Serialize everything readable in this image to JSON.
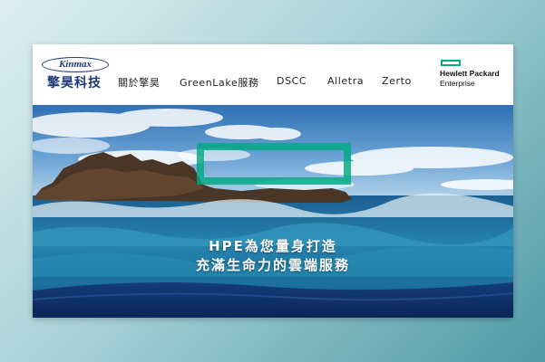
{
  "header": {
    "logo": {
      "brand": "Kinmax",
      "name_cn": "擎昊科技"
    },
    "nav": [
      {
        "label": "關於擎昊"
      },
      {
        "label": "GreenLake服務"
      },
      {
        "label": "DSCC"
      },
      {
        "label": "Alletra"
      },
      {
        "label": "Zerto"
      }
    ],
    "partner_logo": {
      "line1": "Hewlett Packard",
      "line2": "Enterprise"
    }
  },
  "hero": {
    "title_line1": "HPE為您量身打造",
    "title_line2": "充滿生命力的雲端服務"
  },
  "colors": {
    "hpe_green": "#01a982",
    "brand_blue": "#1f3a7a",
    "sky": "#2f6fb3",
    "sea": "#1c6fa0"
  }
}
